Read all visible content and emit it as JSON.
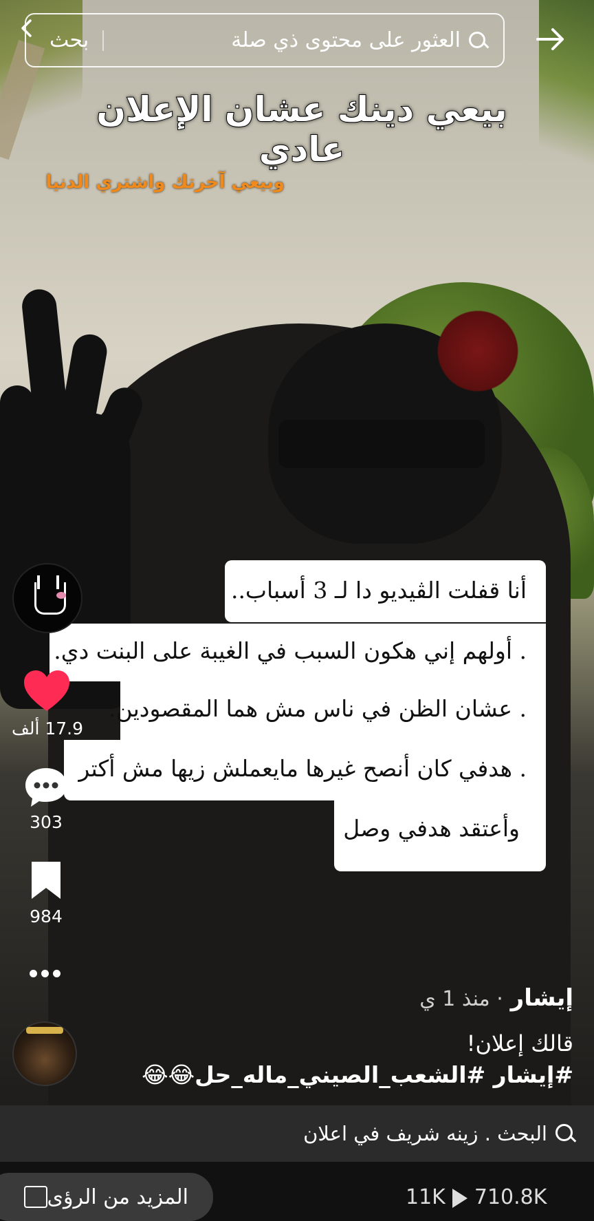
{
  "search": {
    "placeholder": "العثور على محتوى ذي صلة",
    "submit_label": "بحث"
  },
  "video": {
    "headline": "بيعي دينك عشان الإعلان عادي",
    "subline": "وبيعي آخرتك واشتري الدنيا",
    "caption_lines": [
      "أنا قفلت الڤيديو دا لـ 3 أسباب..",
      ". أولهم إني هكون السبب في الغيبة على البنت دي.",
      ". عشان الظن في ناس مش هما المقصودين.",
      ". هدفي كان أنصح غيرها مايعملش زيها مش أكتر",
      "وأعتقد هدفي وصل"
    ]
  },
  "actions": {
    "likes": "17.9 ألف",
    "comments": "303",
    "saves": "984",
    "like_color": "#fe2c55"
  },
  "post": {
    "author": "إيشار",
    "time": "· منذ 1 ي",
    "description": "قالك إعلان!",
    "hashtags": "#إيشار #الشعب_الصيني_ماله_حل😂😂"
  },
  "related_search": {
    "text": "البحث . زينه شريف في اعلان"
  },
  "bottom": {
    "insights_label": "المزيد من الرؤى",
    "shares": "11K",
    "views": "710.8K"
  }
}
